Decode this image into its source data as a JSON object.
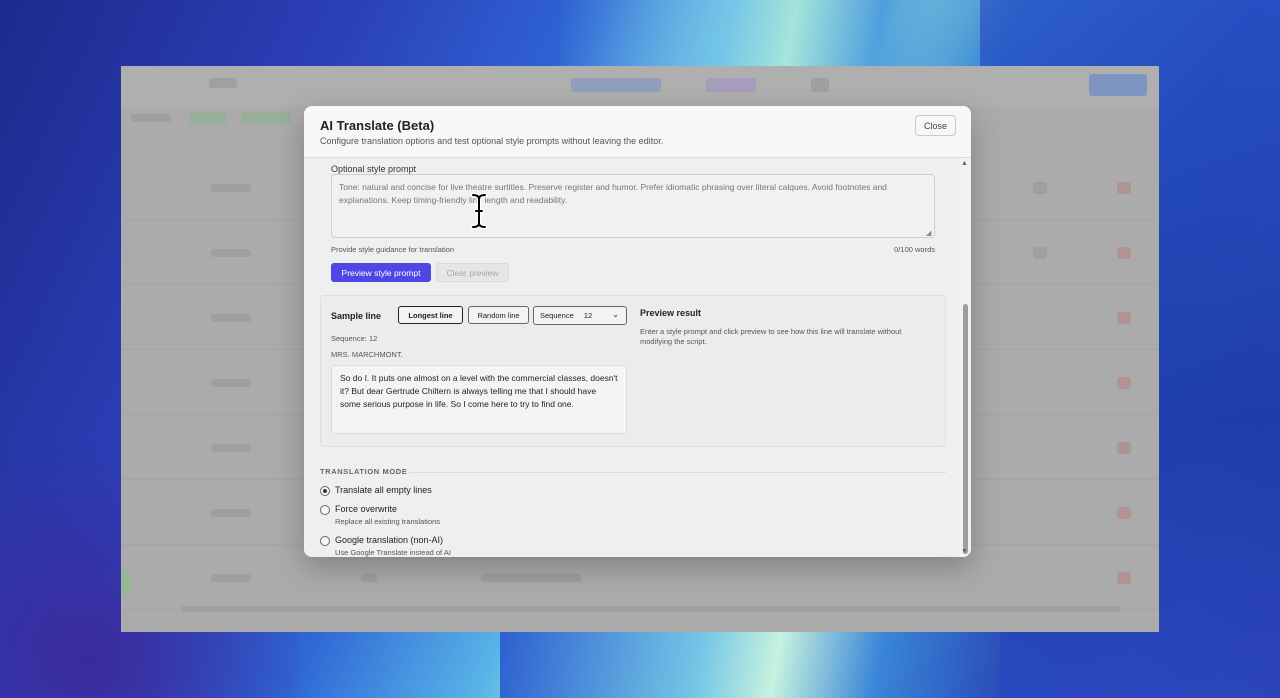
{
  "modal": {
    "title": "AI Translate (Beta)",
    "subtitle": "Configure translation options and test optional style prompts without leaving the editor.",
    "close_label": "Close"
  },
  "style_prompt": {
    "label": "Optional style prompt",
    "placeholder": "Tone: natural and concise for live theatre surtitles. Preserve register and humor. Prefer idiomatic phrasing over literal calques. Avoid footnotes and explanations. Keep timing-friendly line length and readability.",
    "helper": "Provide style guidance for translation",
    "word_count": "0/100 words",
    "preview_label": "Preview style prompt",
    "clear_label": "Clear preview"
  },
  "sample": {
    "title": "Sample line",
    "longest_label": "Longest line",
    "random_label": "Random line",
    "sequence_select_label": "Sequence",
    "sequence_select_value": "12",
    "sequence_info": "Sequence: 12",
    "speaker": "MRS. MARCHMONT.",
    "text": "So do I. It puts one almost on a level with the commercial classes, doesn't it? But dear Gertrude Chiltern is always telling me that I should have some serious purpose in life. So I come here to try to find one."
  },
  "preview": {
    "title": "Preview result",
    "description": "Enter a style prompt and click preview to see how this line will translate without modifying the script."
  },
  "translation_mode": {
    "title": "TRANSLATION MODE",
    "options": [
      {
        "label": "Translate all empty lines",
        "description": "",
        "checked": true
      },
      {
        "label": "Force overwrite",
        "description": "Replace all existing translations",
        "checked": false
      },
      {
        "label": "Google translation (non-AI)",
        "description": "Use Google Translate instead of AI",
        "checked": false
      }
    ]
  },
  "icons": {
    "chevron": "chevron-down-icon",
    "cursor": "text-cursor-icon"
  },
  "colors": {
    "accent": "#4f46e5"
  }
}
